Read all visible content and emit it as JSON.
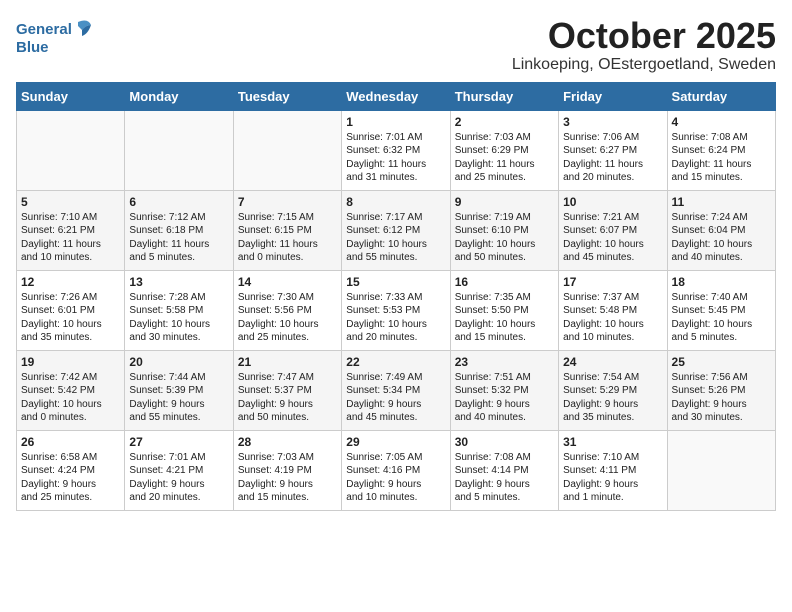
{
  "header": {
    "logo_line1": "General",
    "logo_line2": "Blue",
    "month": "October 2025",
    "location": "Linkoeping, OEstergoetland, Sweden"
  },
  "days_of_week": [
    "Sunday",
    "Monday",
    "Tuesday",
    "Wednesday",
    "Thursday",
    "Friday",
    "Saturday"
  ],
  "weeks": [
    [
      {
        "day": "",
        "info": ""
      },
      {
        "day": "",
        "info": ""
      },
      {
        "day": "",
        "info": ""
      },
      {
        "day": "1",
        "info": "Sunrise: 7:01 AM\nSunset: 6:32 PM\nDaylight: 11 hours\nand 31 minutes."
      },
      {
        "day": "2",
        "info": "Sunrise: 7:03 AM\nSunset: 6:29 PM\nDaylight: 11 hours\nand 25 minutes."
      },
      {
        "day": "3",
        "info": "Sunrise: 7:06 AM\nSunset: 6:27 PM\nDaylight: 11 hours\nand 20 minutes."
      },
      {
        "day": "4",
        "info": "Sunrise: 7:08 AM\nSunset: 6:24 PM\nDaylight: 11 hours\nand 15 minutes."
      }
    ],
    [
      {
        "day": "5",
        "info": "Sunrise: 7:10 AM\nSunset: 6:21 PM\nDaylight: 11 hours\nand 10 minutes."
      },
      {
        "day": "6",
        "info": "Sunrise: 7:12 AM\nSunset: 6:18 PM\nDaylight: 11 hours\nand 5 minutes."
      },
      {
        "day": "7",
        "info": "Sunrise: 7:15 AM\nSunset: 6:15 PM\nDaylight: 11 hours\nand 0 minutes."
      },
      {
        "day": "8",
        "info": "Sunrise: 7:17 AM\nSunset: 6:12 PM\nDaylight: 10 hours\nand 55 minutes."
      },
      {
        "day": "9",
        "info": "Sunrise: 7:19 AM\nSunset: 6:10 PM\nDaylight: 10 hours\nand 50 minutes."
      },
      {
        "day": "10",
        "info": "Sunrise: 7:21 AM\nSunset: 6:07 PM\nDaylight: 10 hours\nand 45 minutes."
      },
      {
        "day": "11",
        "info": "Sunrise: 7:24 AM\nSunset: 6:04 PM\nDaylight: 10 hours\nand 40 minutes."
      }
    ],
    [
      {
        "day": "12",
        "info": "Sunrise: 7:26 AM\nSunset: 6:01 PM\nDaylight: 10 hours\nand 35 minutes."
      },
      {
        "day": "13",
        "info": "Sunrise: 7:28 AM\nSunset: 5:58 PM\nDaylight: 10 hours\nand 30 minutes."
      },
      {
        "day": "14",
        "info": "Sunrise: 7:30 AM\nSunset: 5:56 PM\nDaylight: 10 hours\nand 25 minutes."
      },
      {
        "day": "15",
        "info": "Sunrise: 7:33 AM\nSunset: 5:53 PM\nDaylight: 10 hours\nand 20 minutes."
      },
      {
        "day": "16",
        "info": "Sunrise: 7:35 AM\nSunset: 5:50 PM\nDaylight: 10 hours\nand 15 minutes."
      },
      {
        "day": "17",
        "info": "Sunrise: 7:37 AM\nSunset: 5:48 PM\nDaylight: 10 hours\nand 10 minutes."
      },
      {
        "day": "18",
        "info": "Sunrise: 7:40 AM\nSunset: 5:45 PM\nDaylight: 10 hours\nand 5 minutes."
      }
    ],
    [
      {
        "day": "19",
        "info": "Sunrise: 7:42 AM\nSunset: 5:42 PM\nDaylight: 10 hours\nand 0 minutes."
      },
      {
        "day": "20",
        "info": "Sunrise: 7:44 AM\nSunset: 5:39 PM\nDaylight: 9 hours\nand 55 minutes."
      },
      {
        "day": "21",
        "info": "Sunrise: 7:47 AM\nSunset: 5:37 PM\nDaylight: 9 hours\nand 50 minutes."
      },
      {
        "day": "22",
        "info": "Sunrise: 7:49 AM\nSunset: 5:34 PM\nDaylight: 9 hours\nand 45 minutes."
      },
      {
        "day": "23",
        "info": "Sunrise: 7:51 AM\nSunset: 5:32 PM\nDaylight: 9 hours\nand 40 minutes."
      },
      {
        "day": "24",
        "info": "Sunrise: 7:54 AM\nSunset: 5:29 PM\nDaylight: 9 hours\nand 35 minutes."
      },
      {
        "day": "25",
        "info": "Sunrise: 7:56 AM\nSunset: 5:26 PM\nDaylight: 9 hours\nand 30 minutes."
      }
    ],
    [
      {
        "day": "26",
        "info": "Sunrise: 6:58 AM\nSunset: 4:24 PM\nDaylight: 9 hours\nand 25 minutes."
      },
      {
        "day": "27",
        "info": "Sunrise: 7:01 AM\nSunset: 4:21 PM\nDaylight: 9 hours\nand 20 minutes."
      },
      {
        "day": "28",
        "info": "Sunrise: 7:03 AM\nSunset: 4:19 PM\nDaylight: 9 hours\nand 15 minutes."
      },
      {
        "day": "29",
        "info": "Sunrise: 7:05 AM\nSunset: 4:16 PM\nDaylight: 9 hours\nand 10 minutes."
      },
      {
        "day": "30",
        "info": "Sunrise: 7:08 AM\nSunset: 4:14 PM\nDaylight: 9 hours\nand 5 minutes."
      },
      {
        "day": "31",
        "info": "Sunrise: 7:10 AM\nSunset: 4:11 PM\nDaylight: 9 hours\nand 1 minute."
      },
      {
        "day": "",
        "info": ""
      }
    ]
  ]
}
